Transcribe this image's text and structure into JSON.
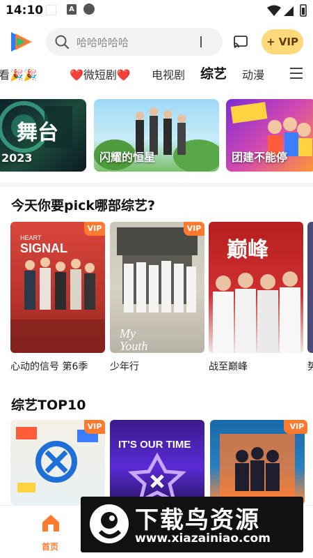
{
  "status_bar": {
    "time": "14:10"
  },
  "header": {
    "logo": "video-app-logo",
    "search": {
      "placeholder": "哈哈哈哈哈"
    },
    "vip_label": "+ VIP"
  },
  "tabs": [
    "看🎉🎉",
    "❤️微短剧❤️",
    "电视剧",
    "综艺",
    "动漫"
  ],
  "active_tab": "综艺",
  "banners": [
    {
      "label": "2023"
    },
    {
      "label": "闪耀的恒星"
    },
    {
      "label": "团建不能停"
    }
  ],
  "pick_section": {
    "title": "今天你要pick哪部综艺?",
    "items": [
      {
        "title": "心动的信号 第6季",
        "badge": "VIP"
      },
      {
        "title": "少年行",
        "badge": "VIP"
      },
      {
        "title": "战至巅峰",
        "badge": "VIP"
      },
      {
        "title": "势"
      }
    ]
  },
  "top10_section": {
    "title": "综艺TOP10",
    "items": [
      {
        "badge": "VIP"
      },
      {
        "badge": "VIP"
      },
      {
        "badge": "VIP"
      }
    ]
  },
  "bottom_nav": {
    "home_label": "首页"
  },
  "watermark": {
    "title": "下载鸟资源",
    "url": "www.xiazainiao.com"
  },
  "colors": {
    "accent": "#ff7a2e",
    "vip_gold": "#ffd97a",
    "brand_blue": "#2e7bf6"
  }
}
